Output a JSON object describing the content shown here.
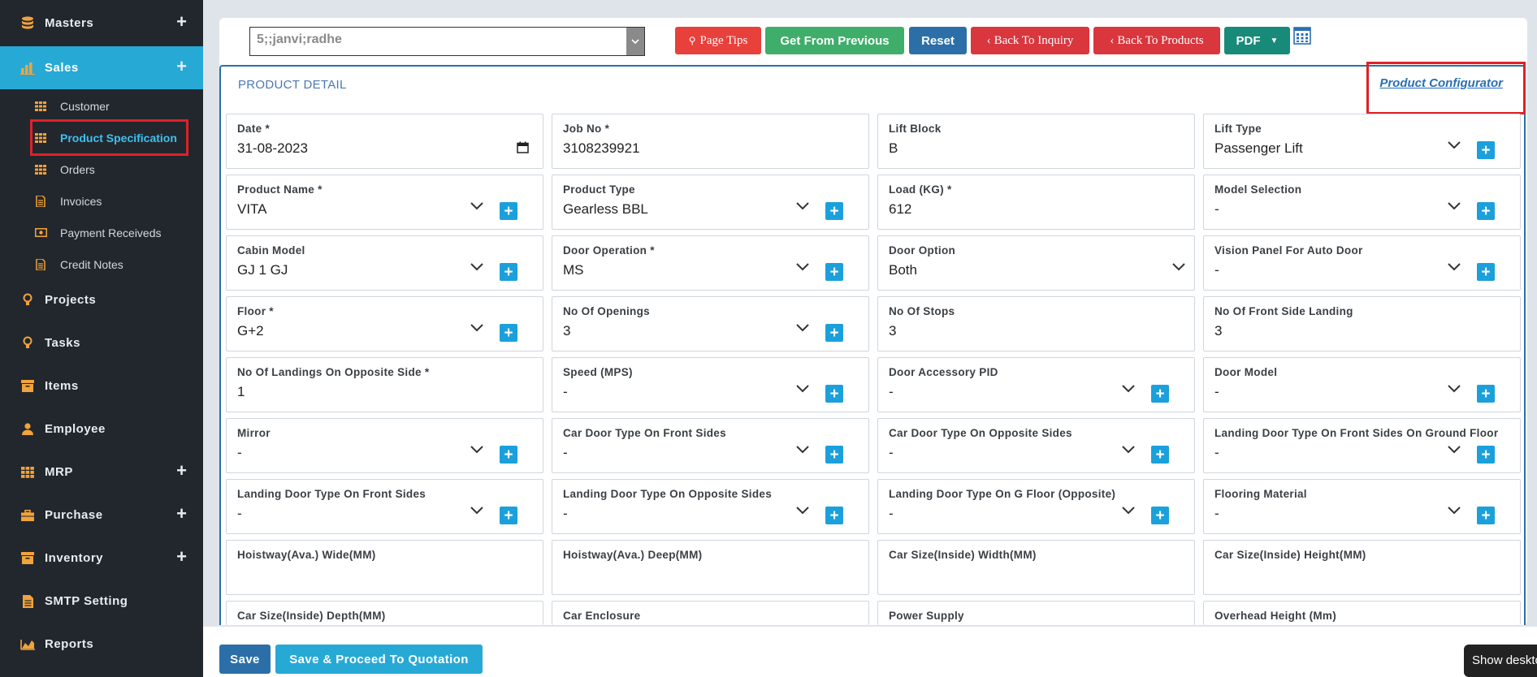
{
  "sidebar": {
    "masters": "Masters",
    "sales": "Sales",
    "customer": "Customer",
    "product_spec": "Product Specification",
    "orders": "Orders",
    "invoices": "Invoices",
    "payment_receiveds": "Payment Receiveds",
    "credit_notes": "Credit Notes",
    "projects": "Projects",
    "tasks": "Tasks",
    "items": "Items",
    "employee": "Employee",
    "mrp": "MRP",
    "purchase": "Purchase",
    "inventory": "Inventory",
    "smtp": "SMTP Setting",
    "reports": "Reports"
  },
  "toolbar": {
    "inquiry_value": "5;;janvi;radhe",
    "page_tips": "Page Tips",
    "get_from_previous": "Get From Previous",
    "reset": "Reset",
    "back_to_inquiry": "Back To Inquiry",
    "back_to_products": "Back To Products",
    "pdf": "PDF"
  },
  "detail": {
    "title": "PRODUCT DETAIL",
    "configurator": "Product Configurator"
  },
  "fields": {
    "date": {
      "label": "Date *",
      "value": "31-08-2023"
    },
    "job_no": {
      "label": "Job No *",
      "value": "3108239921"
    },
    "lift_block": {
      "label": "Lift Block",
      "value": "B"
    },
    "lift_type": {
      "label": "Lift Type",
      "value": "Passenger Lift"
    },
    "product_name": {
      "label": "Product Name *",
      "value": "VITA"
    },
    "product_type": {
      "label": "Product Type",
      "value": "Gearless BBL"
    },
    "load": {
      "label": "Load (KG) *",
      "value": "612"
    },
    "model_selection": {
      "label": "Model Selection",
      "value": "-"
    },
    "cabin_model": {
      "label": "Cabin Model",
      "value": "GJ 1 GJ"
    },
    "door_operation": {
      "label": "Door Operation *",
      "value": "MS"
    },
    "door_option": {
      "label": "Door Option",
      "value": "Both"
    },
    "vision_panel": {
      "label": "Vision Panel For Auto Door",
      "value": "-"
    },
    "floor": {
      "label": "Floor *",
      "value": "G+2"
    },
    "no_openings": {
      "label": "No Of Openings",
      "value": "3"
    },
    "no_stops": {
      "label": "No Of Stops",
      "value": "3"
    },
    "no_front_landing": {
      "label": "No Of Front Side Landing",
      "value": "3"
    },
    "no_opposite_landing": {
      "label": "No Of Landings On Opposite Side *",
      "value": "1"
    },
    "speed": {
      "label": "Speed (MPS)",
      "value": "-"
    },
    "door_accessory": {
      "label": "Door Accessory PID",
      "value": "-"
    },
    "door_model": {
      "label": "Door Model",
      "value": "-"
    },
    "mirror": {
      "label": "Mirror",
      "value": "-"
    },
    "car_door_front": {
      "label": "Car Door Type On Front Sides",
      "value": "-"
    },
    "car_door_opposite": {
      "label": "Car Door Type On Opposite Sides",
      "value": "-"
    },
    "landing_door_front_ground": {
      "label": "Landing Door Type On Front Sides On Ground Floor",
      "value": "-"
    },
    "landing_door_front": {
      "label": "Landing Door Type On Front Sides",
      "value": "-"
    },
    "landing_door_opposite": {
      "label": "Landing Door Type On Opposite Sides",
      "value": "-"
    },
    "landing_door_g_opposite": {
      "label": "Landing Door Type On G Floor (Opposite)",
      "value": "-"
    },
    "flooring_material": {
      "label": "Flooring Material",
      "value": "-"
    },
    "hoistway_wide": {
      "label": "Hoistway(Ava.) Wide(MM)",
      "value": ""
    },
    "hoistway_deep": {
      "label": "Hoistway(Ava.) Deep(MM)",
      "value": ""
    },
    "car_width": {
      "label": "Car Size(Inside) Width(MM)",
      "value": ""
    },
    "car_height": {
      "label": "Car Size(Inside) Height(MM)",
      "value": ""
    },
    "car_depth": {
      "label": "Car Size(Inside) Depth(MM)",
      "value": ""
    },
    "car_enclosure": {
      "label": "Car Enclosure",
      "value": ""
    },
    "power_supply": {
      "label": "Power Supply",
      "value": ""
    },
    "overhead_height": {
      "label": "Overhead Height (Mm)",
      "value": ""
    }
  },
  "footer": {
    "save": "Save",
    "save_proceed": "Save & Proceed To Quotation",
    "desktop_tooltip": "Show deskto"
  },
  "colors": {
    "sidebar_bg": "#22272e",
    "active_bg": "#27a9d6",
    "icon_orange": "#f2a33a",
    "highlight_red": "#e02128",
    "add_btn": "#1ba0dc"
  }
}
